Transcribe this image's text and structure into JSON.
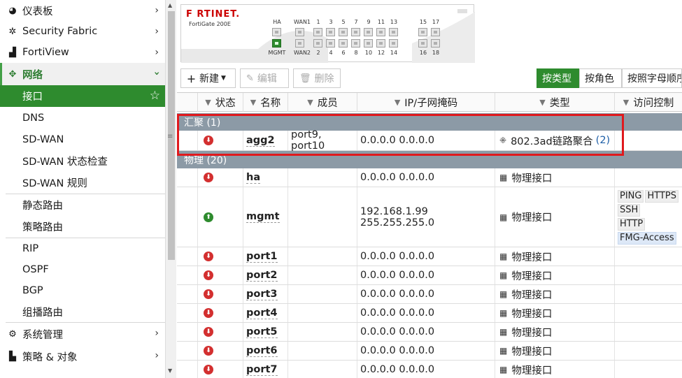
{
  "sidebar": {
    "top_items": [
      {
        "label": "仪表板",
        "icon": "dashboard-icon"
      },
      {
        "label": "Security Fabric",
        "icon": "fabric-icon"
      },
      {
        "label": "FortiView",
        "icon": "chart-icon"
      }
    ],
    "network": {
      "label": "网络",
      "icon": "network-move-icon",
      "sub_items": [
        "接口",
        "DNS",
        "SD-WAN",
        "SD-WAN 状态检查",
        "SD-WAN 规则",
        "静态路由",
        "策略路由",
        "RIP",
        "OSPF",
        "BGP",
        "组播路由"
      ]
    },
    "bottom_items": [
      {
        "label": "系统管理",
        "icon": "gear-icon"
      },
      {
        "label": "策略 & 对象",
        "icon": "policy-icon"
      }
    ]
  },
  "device": {
    "brand": "F RTINET.",
    "model": "FortiGate 200E",
    "labels_top": [
      "HA",
      "WAN1",
      "1",
      "3",
      "5",
      "7",
      "9",
      "11",
      "13",
      "15",
      "17"
    ],
    "labels_bottom": [
      "MGMT",
      "WAN2",
      "2",
      "4",
      "6",
      "8",
      "10",
      "12",
      "14",
      "16",
      "18"
    ]
  },
  "toolbar": {
    "new": "新建",
    "edit": "编辑",
    "delete": "删除",
    "group_by_type": "按类型",
    "group_by_role": "按角色",
    "group_by_alpha": "按照字母顺序"
  },
  "table": {
    "headers": {
      "status": "状态",
      "name": "名称",
      "members": "成员",
      "ip": "IP/子网掩码",
      "type": "类型",
      "access": "访问控制"
    },
    "groups": [
      {
        "label": "汇聚 (1)"
      },
      {
        "label": "物理 (20)"
      }
    ],
    "agg_row": {
      "status": "down",
      "name": "agg2",
      "members": "port9, port10",
      "ip": "0.0.0.0 0.0.0.0",
      "type": "802.3ad链路聚合",
      "type_count": "(2)"
    },
    "physical_rows": [
      {
        "status": "down",
        "name": "ha",
        "ip": "0.0.0.0 0.0.0.0",
        "type": "物理接口"
      },
      {
        "status": "up",
        "name": "mgmt",
        "ip": "192.168.1.99 255.255.255.0",
        "type": "物理接口",
        "access": [
          "PING",
          "HTTPS",
          "SSH",
          "HTTP",
          "FMG-Access"
        ]
      },
      {
        "status": "down",
        "name": "port1",
        "ip": "0.0.0.0 0.0.0.0",
        "type": "物理接口"
      },
      {
        "status": "down",
        "name": "port2",
        "ip": "0.0.0.0 0.0.0.0",
        "type": "物理接口"
      },
      {
        "status": "down",
        "name": "port3",
        "ip": "0.0.0.0 0.0.0.0",
        "type": "物理接口"
      },
      {
        "status": "down",
        "name": "port4",
        "ip": "0.0.0.0 0.0.0.0",
        "type": "物理接口"
      },
      {
        "status": "down",
        "name": "port5",
        "ip": "0.0.0.0 0.0.0.0",
        "type": "物理接口"
      },
      {
        "status": "down",
        "name": "port6",
        "ip": "0.0.0.0 0.0.0.0",
        "type": "物理接口"
      },
      {
        "status": "down",
        "name": "port7",
        "ip": "0.0.0.0 0.0.0.0",
        "type": "物理接口"
      }
    ]
  },
  "colors": {
    "accent": "#2e8b2e",
    "group_header": "#8c9aa6",
    "status_down": "#d32f2f",
    "status_up": "#2e8b2e",
    "highlight": "#e0191d"
  }
}
